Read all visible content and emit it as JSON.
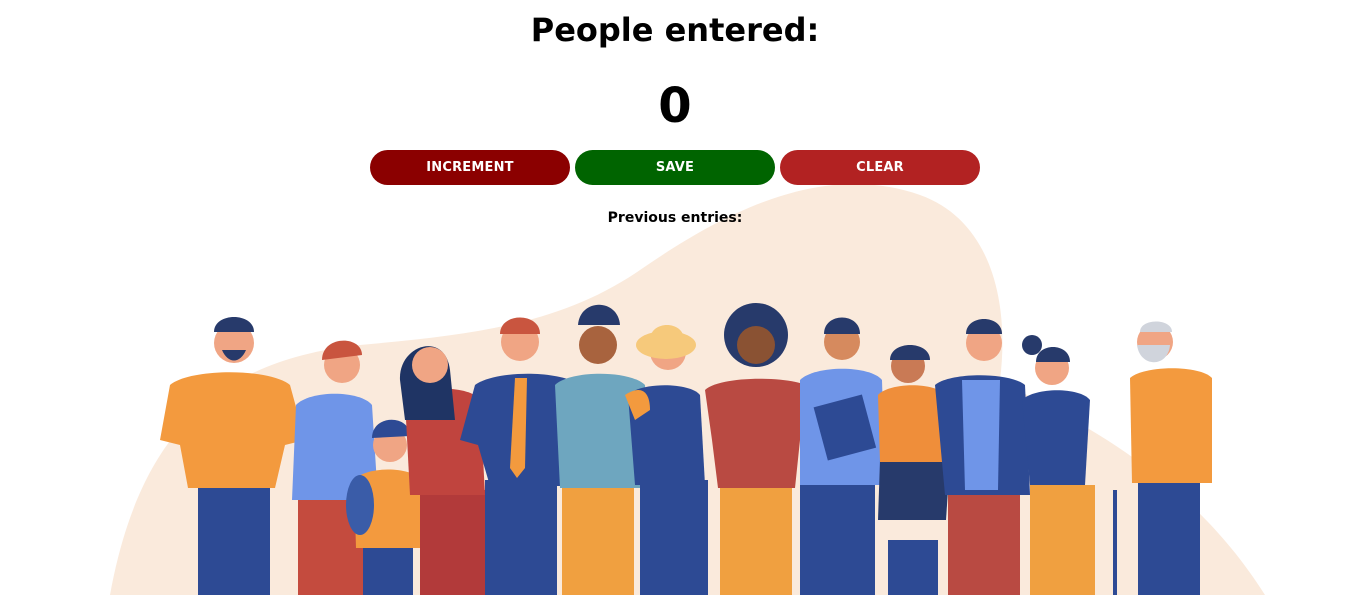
{
  "header": {
    "title": "People entered:"
  },
  "counter": {
    "value": "0"
  },
  "buttons": {
    "increment_label": "INCREMENT",
    "save_label": "SAVE",
    "clear_label": "CLEAR"
  },
  "entries": {
    "label": "Previous entries:",
    "items": []
  },
  "colors": {
    "increment": "#8b0000",
    "save": "#006400",
    "clear": "#b22222",
    "blob": "#faeadc"
  },
  "illustration": {
    "name": "diverse-crowd-illustration"
  }
}
